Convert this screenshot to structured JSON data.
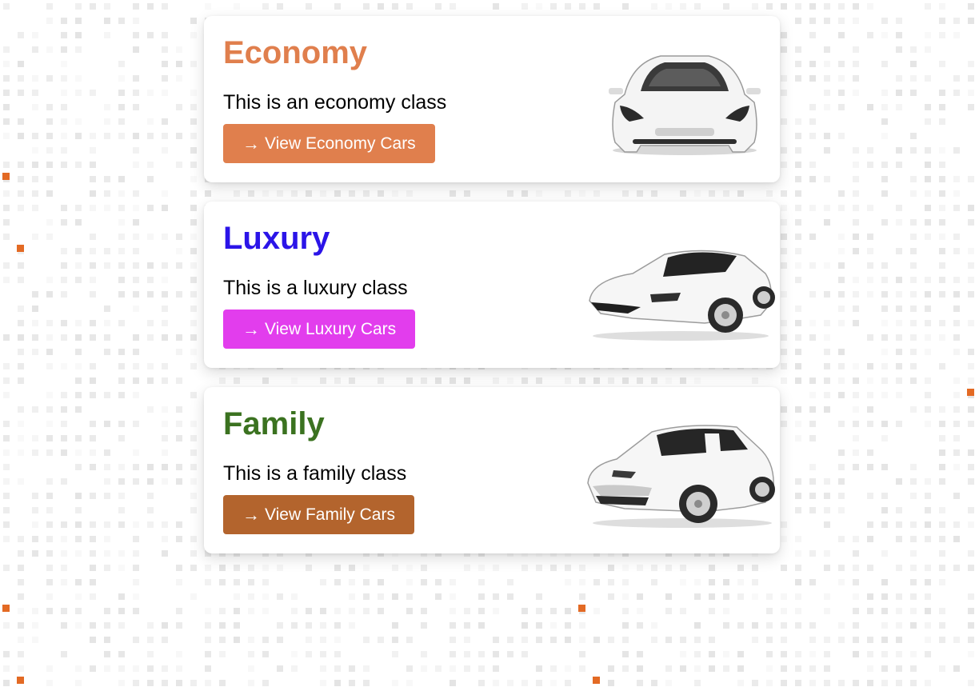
{
  "colors": {
    "page_background": "#ffffff",
    "grid_cell": "#ececec",
    "accent_dot": "#e36a24"
  },
  "cards": [
    {
      "title": "Economy",
      "title_color": "#e07f4d",
      "description": "This is an economy class",
      "button_label": "View Economy Cars",
      "button_color": "#e07f4d",
      "icon": "arrow-right-icon",
      "image": "white-sedan-front-view"
    },
    {
      "title": "Luxury",
      "title_color": "#2b14e8",
      "description": "This is a luxury class",
      "button_label": "View Luxury Cars",
      "button_color": "#e23ded",
      "icon": "arrow-right-icon",
      "image": "white-sports-car"
    },
    {
      "title": "Family",
      "title_color": "#3b7220",
      "description": "This is a family class",
      "button_label": "View Family Cars",
      "button_color": "#b3642d",
      "icon": "arrow-right-icon",
      "image": "white-suv"
    }
  ]
}
